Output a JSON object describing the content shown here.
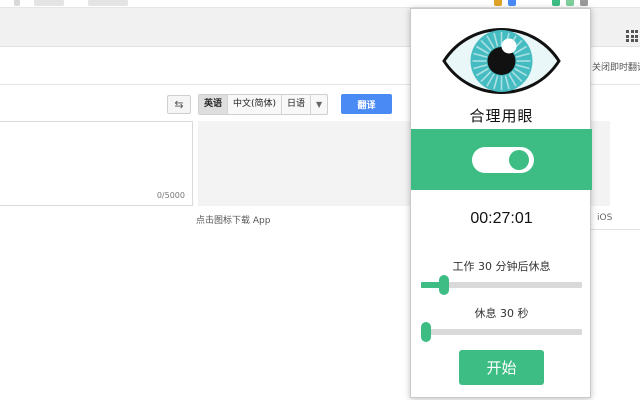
{
  "colors": {
    "accent_green": "#3dbd84",
    "translate_blue": "#4a8af4",
    "eye_teal": "#45bcc1",
    "track_grey": "#d9d9d9"
  },
  "browser": {
    "apps_icon": "apps-grid-icon"
  },
  "translate_page": {
    "top_right_text": "关闭即时翻译",
    "swap_icon": "swap-languages-icon",
    "languages": [
      "英语",
      "中文(简体)",
      "日语"
    ],
    "active_language_index": 0,
    "dropdown_icon": "chevron-down-icon",
    "translate_button": "翻译",
    "char_count": "0/5000",
    "app_download": "点击图标下载 App",
    "ios_label": "iOS"
  },
  "popup": {
    "logo_icon": "eye-icon",
    "title": "合理用眼",
    "toggle_on": true,
    "timer": "00:27:01",
    "work_label": "工作 30 分钟后休息",
    "work_slider_fraction": 0.14,
    "rest_label": "休息 30 秒",
    "rest_slider_fraction": 0.03,
    "start_button": "开始"
  }
}
